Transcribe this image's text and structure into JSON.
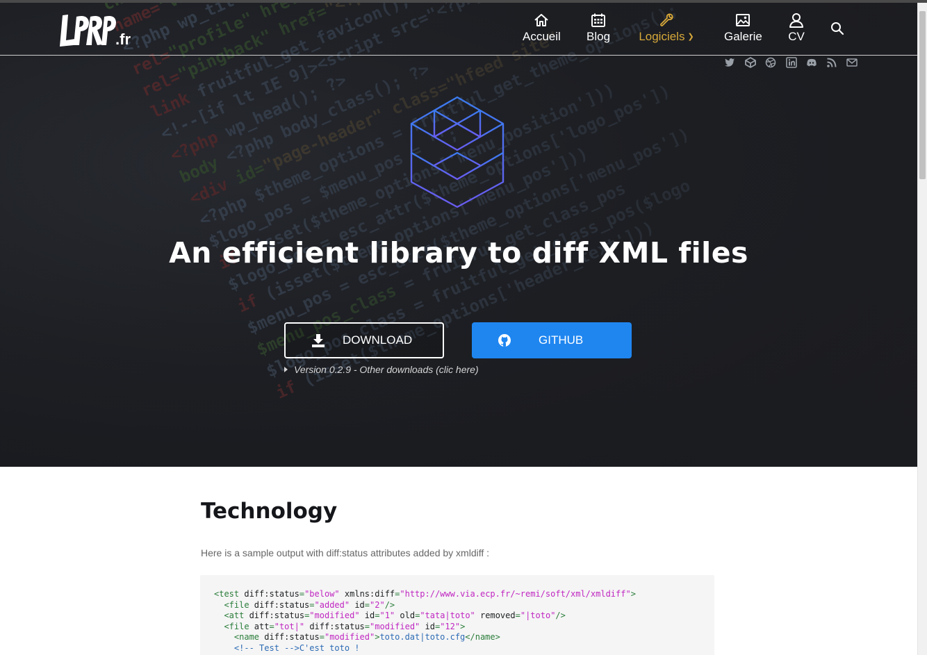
{
  "site": {
    "logo_text": "LPRP",
    "logo_suffix": ".fr"
  },
  "nav": {
    "items": [
      {
        "label": "Accueil",
        "icon": "home-icon"
      },
      {
        "label": "Blog",
        "icon": "calendar-icon"
      },
      {
        "label": "Logiciels",
        "icon": "wrench-icon",
        "active": true,
        "dropdown": true
      },
      {
        "label": "Galerie",
        "icon": "image-icon"
      },
      {
        "label": "CV",
        "icon": "user-icon"
      }
    ],
    "search_icon": "search-icon",
    "active_color": "#d8a93a"
  },
  "socials": [
    "twitter-icon",
    "codepen-icon",
    "dribbble-icon",
    "linkedin-icon",
    "github-icon",
    "rss-icon",
    "mail-icon"
  ],
  "hero": {
    "title": "An efficient library to diff XML files",
    "download_label": "DOWNLOAD",
    "github_label": "GITHUB",
    "version_text": "Version 0.2.9 - Other downloads (clic here)",
    "github_color": "#1f86f0"
  },
  "content": {
    "section_title": "Technology",
    "intro": "Here is a sample output with diff:status attributes added by xmldiff :",
    "code_lines": [
      [
        [
          "tag",
          "<test "
        ],
        [
          "attr",
          "diff:status"
        ],
        [
          "tag",
          "="
        ],
        [
          "val",
          "\"below\""
        ],
        [
          "tag",
          " "
        ],
        [
          "attr",
          "xmlns:diff"
        ],
        [
          "tag",
          "="
        ],
        [
          "val",
          "\"http://www.via.ecp.fr/~remi/soft/xml/xmldiff\""
        ],
        [
          "tag",
          ">"
        ]
      ],
      [
        [
          "tag",
          "  <file "
        ],
        [
          "attr",
          "diff:status"
        ],
        [
          "tag",
          "="
        ],
        [
          "val",
          "\"added\""
        ],
        [
          "tag",
          " "
        ],
        [
          "attr",
          "id"
        ],
        [
          "tag",
          "="
        ],
        [
          "val",
          "\"2\""
        ],
        [
          "tag",
          "/>"
        ]
      ],
      [
        [
          "tag",
          "  <att "
        ],
        [
          "attr",
          "diff:status"
        ],
        [
          "tag",
          "="
        ],
        [
          "val",
          "\"modified\""
        ],
        [
          "tag",
          " "
        ],
        [
          "attr",
          "id"
        ],
        [
          "tag",
          "="
        ],
        [
          "val",
          "\"1\""
        ],
        [
          "tag",
          " "
        ],
        [
          "attr",
          "old"
        ],
        [
          "tag",
          "="
        ],
        [
          "val",
          "\"tata|toto\""
        ],
        [
          "tag",
          " "
        ],
        [
          "attr",
          "removed"
        ],
        [
          "tag",
          "="
        ],
        [
          "val",
          "\"|toto\""
        ],
        [
          "tag",
          "/>"
        ]
      ],
      [
        [
          "tag",
          "  <file "
        ],
        [
          "attr",
          "att"
        ],
        [
          "tag",
          "="
        ],
        [
          "val",
          "\"tot|\""
        ],
        [
          "tag",
          " "
        ],
        [
          "attr",
          "diff:status"
        ],
        [
          "tag",
          "="
        ],
        [
          "val",
          "\"modified\""
        ],
        [
          "tag",
          " "
        ],
        [
          "attr",
          "id"
        ],
        [
          "tag",
          "="
        ],
        [
          "val",
          "\"12\""
        ],
        [
          "tag",
          ">"
        ]
      ],
      [
        [
          "tag",
          "    <name "
        ],
        [
          "attr",
          "diff:status"
        ],
        [
          "tag",
          "="
        ],
        [
          "val",
          "\"modified\""
        ],
        [
          "tag",
          ">"
        ],
        [
          "txt",
          "toto.dat|toto.cfg"
        ],
        [
          "tag",
          "</name>"
        ]
      ],
      [
        [
          "com",
          "    <!-- Test -->C'est toto !"
        ]
      ]
    ]
  }
}
